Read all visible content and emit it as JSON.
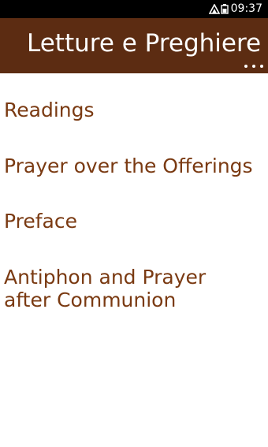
{
  "status_bar": {
    "time": "09:37",
    "icons": [
      "signal-icon",
      "battery-icon"
    ]
  },
  "header": {
    "title": "Letture e Preghiere",
    "more_icon": "ellipsis-icon"
  },
  "menu": {
    "items": [
      {
        "lines": [
          "Readings"
        ]
      },
      {
        "lines": [
          "Prayer over the Offerings"
        ]
      },
      {
        "lines": [
          "Preface"
        ]
      },
      {
        "lines": [
          "Antiphon and Prayer",
          "after Communion"
        ]
      }
    ]
  },
  "colors": {
    "header_bg": "#5c2c12",
    "menu_text": "#7a3a12",
    "status_bg": "#000000",
    "page_bg": "#ffffff"
  }
}
